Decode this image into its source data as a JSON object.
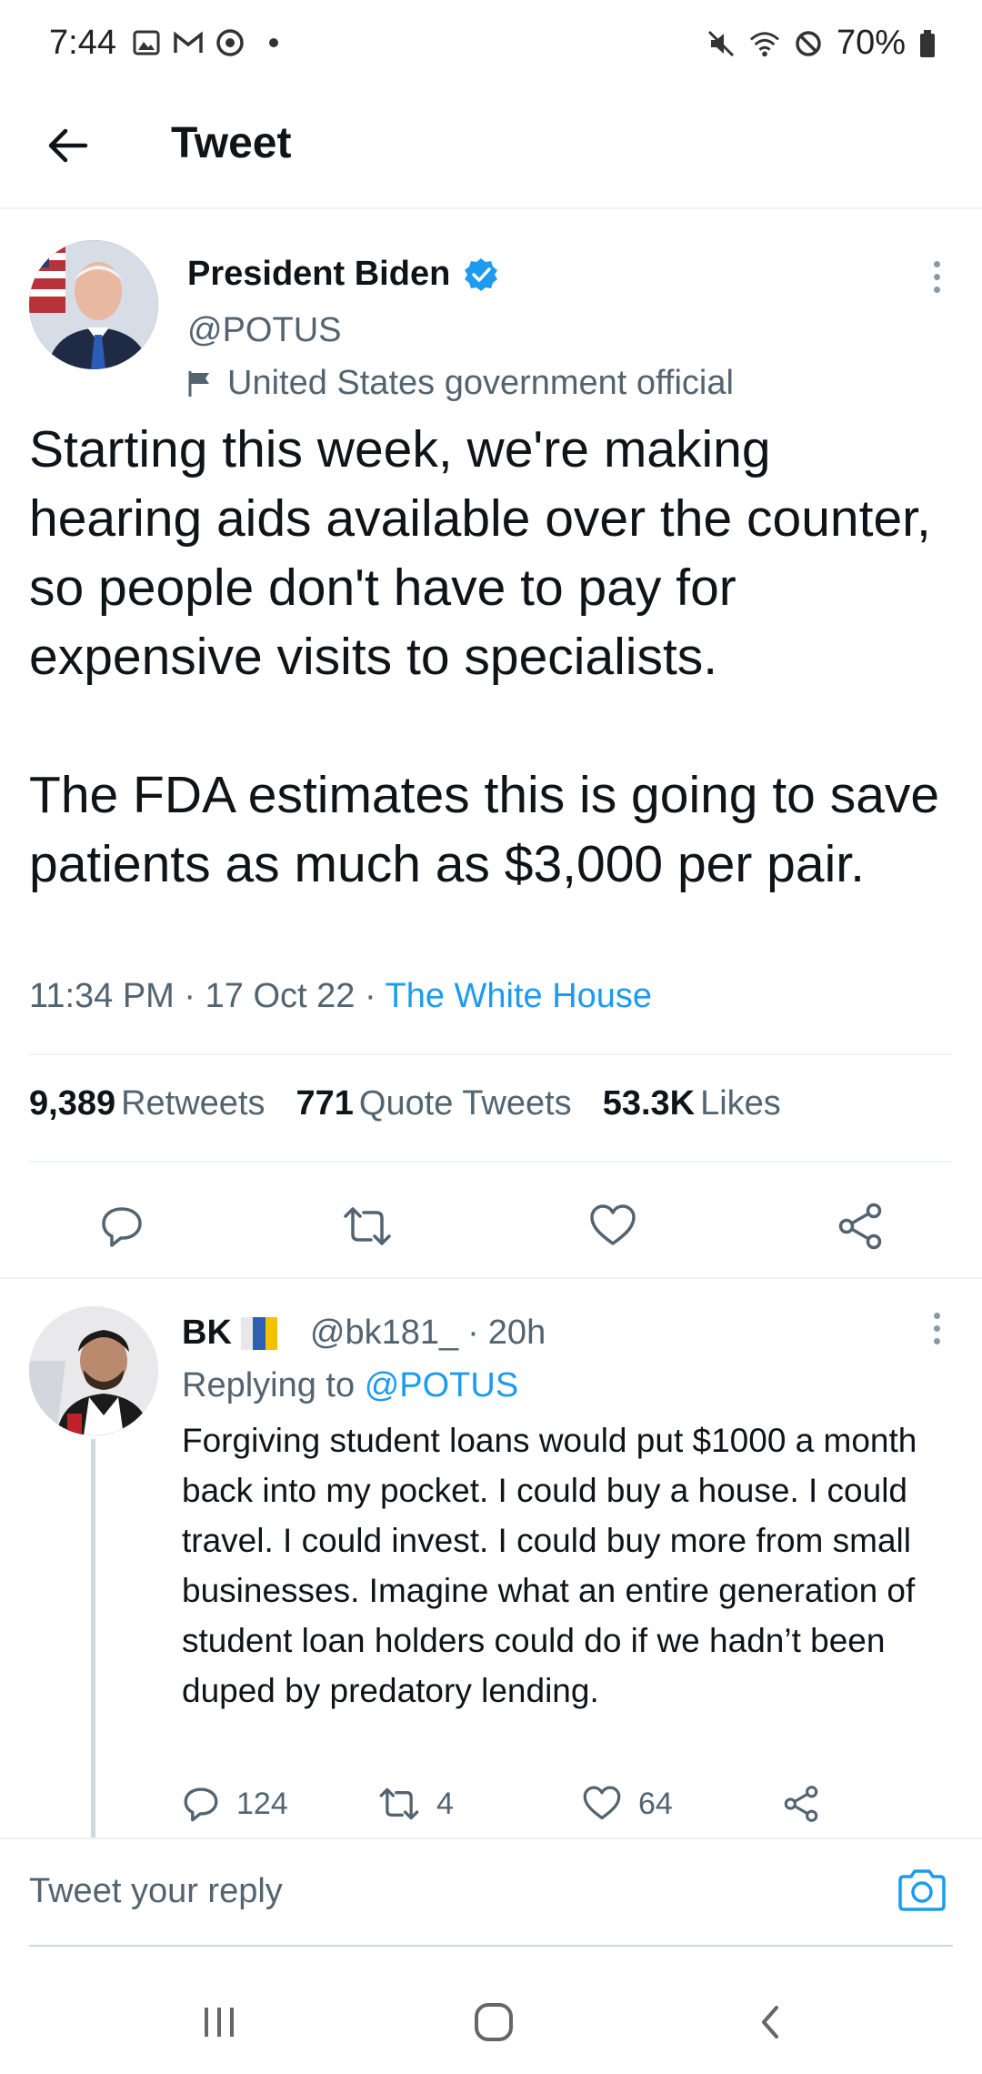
{
  "status_bar": {
    "time": "7:44",
    "battery": "70%",
    "left_icons": [
      "gallery-icon",
      "gmail-icon",
      "chrome-icon"
    ],
    "right_icons": [
      "mute-icon",
      "wifi-icon",
      "block-icon",
      "battery-icon"
    ]
  },
  "header": {
    "title": "Tweet"
  },
  "main_tweet": {
    "name": "President Biden",
    "verified": true,
    "handle": "@POTUS",
    "label": "United States government official",
    "text": "Starting this week, we're making hearing aids available over the counter, so people don't have to pay for expensive visits to specialists.\n\nThe FDA estimates this is going to save patients as much as $3,000 per pair.",
    "time": "11:34 PM",
    "date": "17 Oct 22",
    "source": "The White House",
    "retweets_count": "9,389",
    "retweets_label": "Retweets",
    "quotes_count": "771",
    "quotes_label": "Quote Tweets",
    "likes_count": "53.3K",
    "likes_label": "Likes"
  },
  "reply_tweet": {
    "name": "BK",
    "handle": "@bk181_",
    "age": "20h",
    "replying_prefix": "Replying to",
    "replying_to": "@POTUS",
    "text": "Forgiving student loans would put $1000 a month back into my pocket. I could buy a house. I could travel. I could invest. I could buy more from small businesses. Imagine what an entire generation of student loan holders could do if we hadn’t been duped by predatory lending.",
    "replies": "124",
    "retweets": "4",
    "likes": "64"
  },
  "compose": {
    "placeholder": "Tweet your reply"
  },
  "colors": {
    "accent": "#1d9bf0",
    "secondary_text": "#536471",
    "flag_blue": "#2f5fb3",
    "flag_yellow": "#f2c200"
  }
}
